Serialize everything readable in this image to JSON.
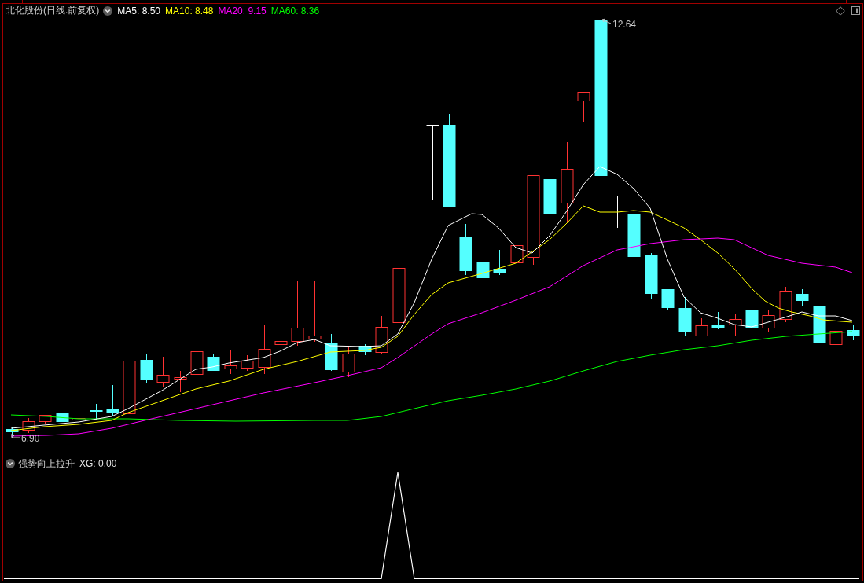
{
  "header": {
    "title": "北化股份(日线.前复权)",
    "indicators": [
      {
        "label": "MA5: 8.50",
        "color": "#ffffff"
      },
      {
        "label": "MA10: 8.48",
        "color": "#ffff00"
      },
      {
        "label": "MA20: 9.15",
        "color": "#ff00ff"
      },
      {
        "label": "MA60: 8.36",
        "color": "#00ff00"
      }
    ]
  },
  "price_chart": {
    "high_label": "12.64",
    "low_label": "6.90"
  },
  "indicator_pane": {
    "title": "强势向上拉升",
    "readout": "XG: 0.00"
  }
}
